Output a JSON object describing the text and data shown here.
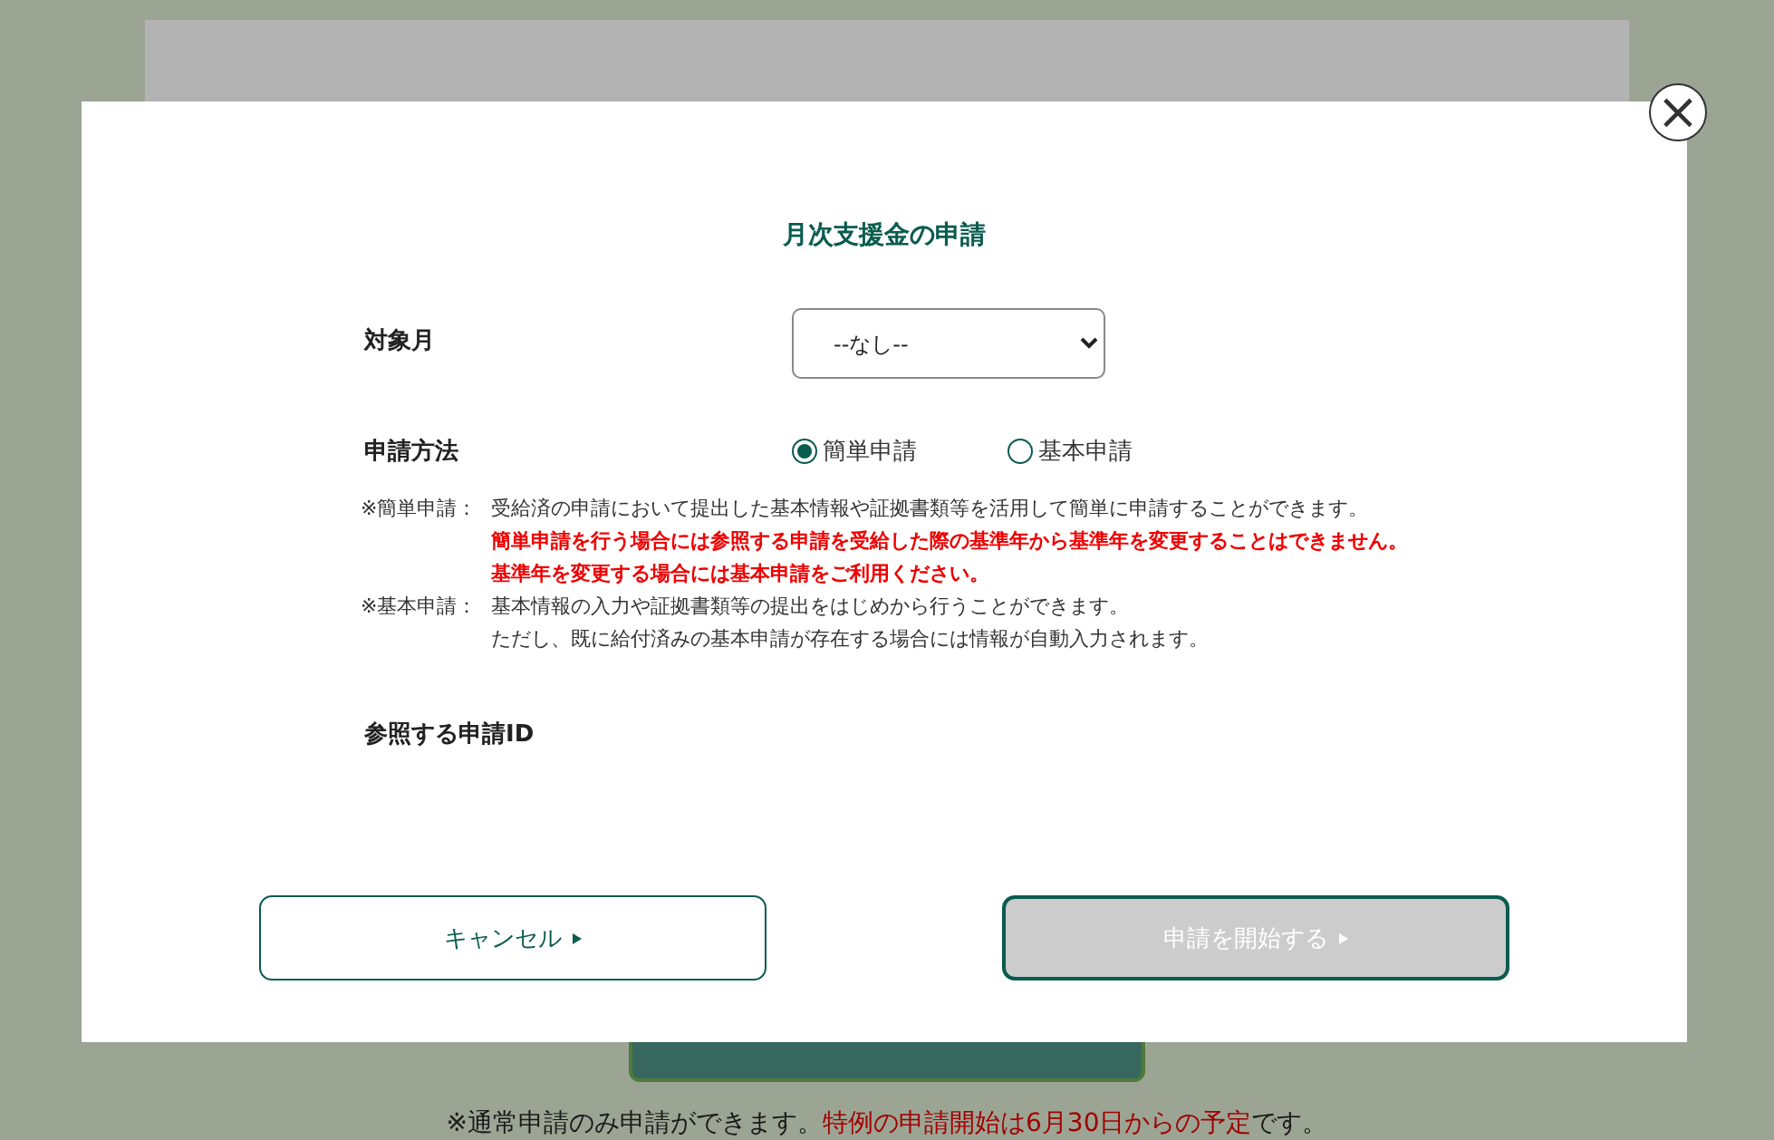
{
  "page": {
    "notice": [
      {
        "text": "※通常申請のみ申請ができます。",
        "kind": "normal"
      },
      {
        "text": "特例の申請開始は6月30日からの予定",
        "kind": "warning"
      },
      {
        "text": "です。",
        "kind": "normal"
      }
    ]
  },
  "dialog": {
    "title": "月次支援金の申請",
    "close": "×",
    "fields": [
      {
        "label": "対象月",
        "kind": "select",
        "value": "--なし--"
      },
      {
        "label": "申請方法",
        "kind": "radio",
        "options": [
          {
            "label": "簡単申請",
            "selected": true
          },
          {
            "label": "基本申請",
            "selected": false
          }
        ]
      }
    ],
    "notes": [
      {
        "prefix": "※簡単申請：",
        "lines": [
          {
            "text": "受給済の申請において提出した基本情報や証拠書類等を活用して簡単に申請することができます。",
            "kind": "normal"
          },
          {
            "text": "簡単申請を行う場合には参照する申請を受給した際の基準年から基準年を変更することはできません。",
            "kind": "warning"
          },
          {
            "text": "基準年を変更する場合には基本申請をご利用ください。",
            "kind": "warning"
          }
        ]
      },
      {
        "prefix": "※基本申請：",
        "lines": [
          {
            "text": "基本情報の入力や証拠書類等の提出をはじめから行うことができます。",
            "kind": "normal"
          },
          {
            "text": "ただし、既に給付済みの基本申請が存在する場合には情報が自動入力されます。",
            "kind": "normal"
          }
        ]
      }
    ],
    "reference_label": "参照する申請ID",
    "buttons": [
      {
        "label": "キャンセル",
        "kind": "secondary",
        "disabled": false
      },
      {
        "label": "申請を開始する",
        "kind": "primary",
        "disabled": true
      }
    ]
  }
}
